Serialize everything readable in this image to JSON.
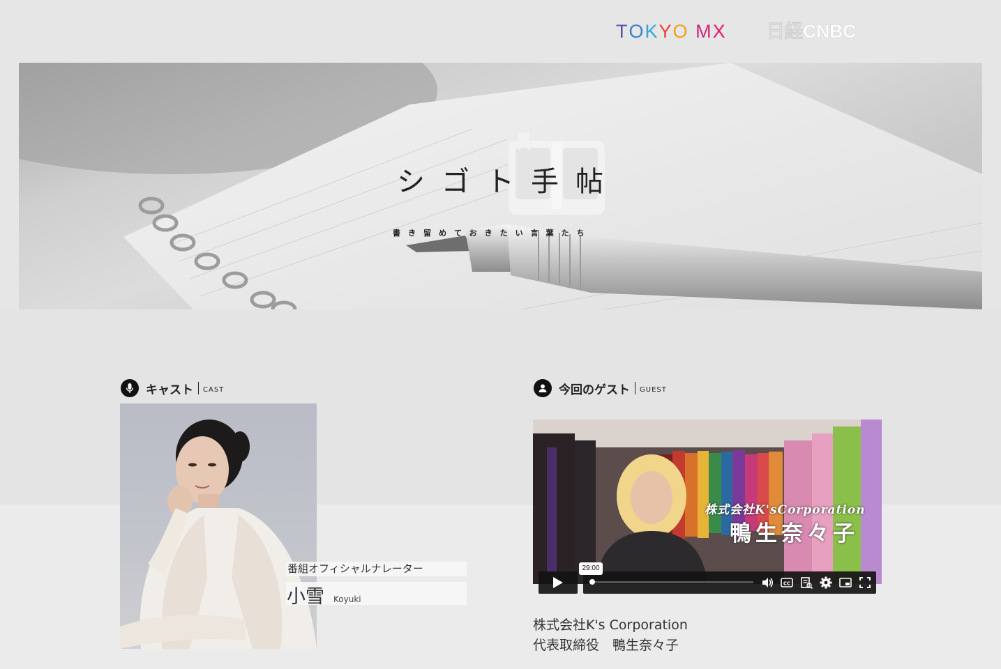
{
  "header": {
    "logo_tokyo": [
      "T",
      "O",
      "K",
      "Y",
      "O",
      " ",
      "M",
      "X"
    ],
    "logo_tokyo_colors": [
      "#5b4fa8",
      "#3b7fd0",
      "#31a5dc",
      "#e8423b",
      "#f0a020",
      "#ffffff",
      "#d4237d",
      "#e8196f"
    ],
    "logo_cnbc": "日経CNBC"
  },
  "hero": {
    "title_chars": [
      "シ",
      "ゴ",
      "ト",
      "手",
      "帖"
    ],
    "subtitle": "書き留めておきたい言葉たち"
  },
  "cast": {
    "heading": "キャスト",
    "heading_en": "CAST",
    "role": "番組オフィシャルナレーター",
    "name": "小雪",
    "name_en": "Koyuki"
  },
  "guest": {
    "heading": "今回のゲスト",
    "heading_en": "GUEST",
    "video_overlay_company": "株式会社K'sCorporation",
    "video_overlay_name": "鴨生奈々子",
    "video_time": "29:00",
    "company": "株式会社K's Corporation",
    "role_name": "代表取締役　鴨生奈々子"
  }
}
